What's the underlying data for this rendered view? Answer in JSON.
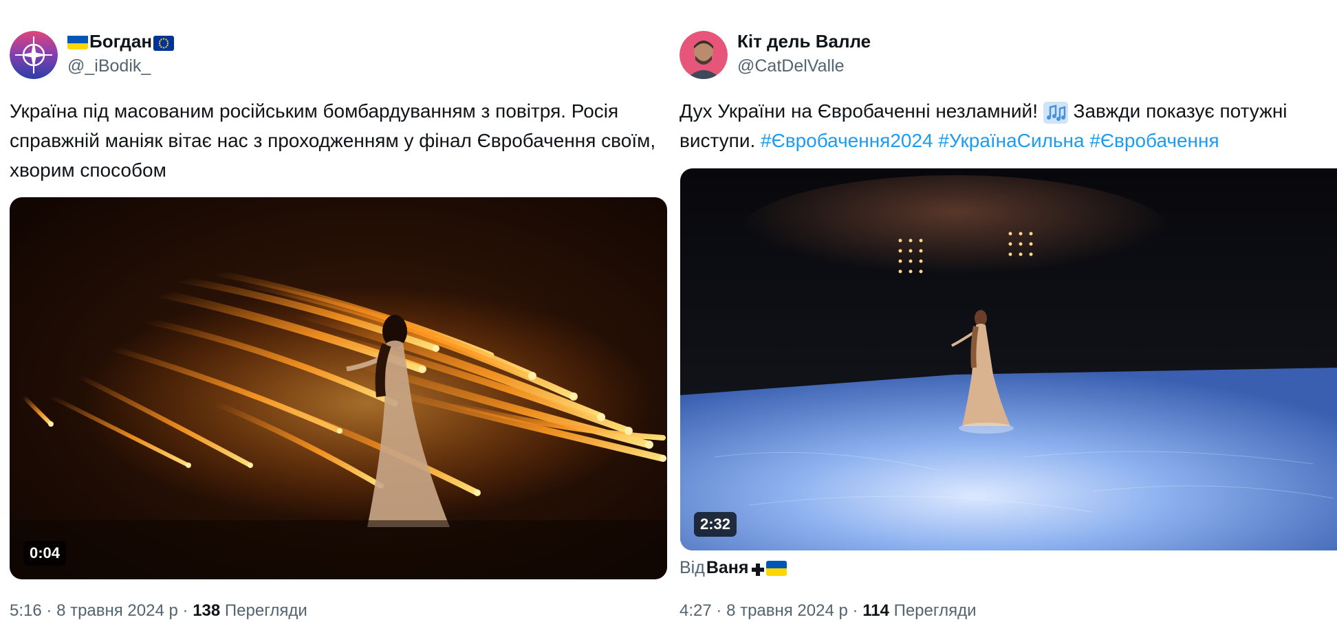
{
  "tweets": [
    {
      "author_name": "Богдан",
      "author_flags": [
        "ukraine-flag",
        "eu-flag"
      ],
      "handle": "@_iBodik_",
      "text": "Україна під масованим російським бомбардуванням з повітря. Росія справжній маніяк вітає нас з проходженням у фінал Євробачення своїм, хворим способом",
      "media": {
        "type": "video",
        "duration": "0:04"
      },
      "time": "5:16",
      "date": "8 травня 2024 р",
      "views_count": "138",
      "views_label": "Перегляди",
      "separator": "·"
    },
    {
      "author_name": "Кіт дель Валле",
      "handle": "@CatDelValle",
      "text_before_icon": "Дух України на Євробаченні незламний! ",
      "text_icon": "music-notes-icon",
      "text_after_icon": "Завжди показує потужні виступи. ",
      "hashtags": [
        "#Євробачення2024",
        "#УкраїнаСильна",
        "#Євробачення"
      ],
      "media": {
        "type": "video",
        "duration": "2:32"
      },
      "attribution_prefix": "Від",
      "attribution_name": "Ваня",
      "attribution_icons": [
        "cross-icon",
        "ukraine-flag"
      ],
      "time": "4:27",
      "date": "8 травня 2024 р",
      "views_count": "114",
      "views_label": "Перегляди",
      "separator": "·"
    }
  ],
  "colors": {
    "text_primary": "#0f1419",
    "text_secondary": "#536471",
    "link": "#1d9bf0",
    "ukraine_blue": "#0057b7",
    "ukraine_yellow": "#ffd700",
    "eu_blue": "#003399"
  }
}
